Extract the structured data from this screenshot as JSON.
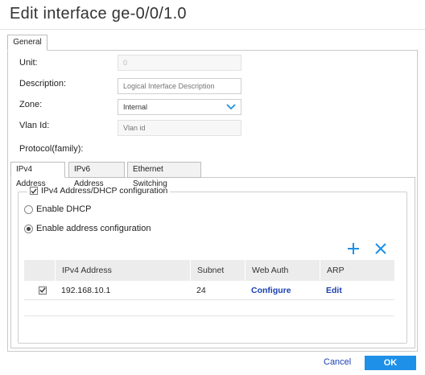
{
  "dialog": {
    "title": "Edit interface ge-0/0/1.0"
  },
  "outer_tab": "General",
  "form": {
    "unit_label": "Unit:",
    "unit_value": "0",
    "description_label": "Description:",
    "description_placeholder": "Logical Interface Description",
    "zone_label": "Zone:",
    "zone_value": "Internal",
    "vlan_label": "Vlan Id:",
    "vlan_placeholder": "Vlan id",
    "protocol_label": "Protocol(family):"
  },
  "sub_tabs": [
    "IPv4 Address",
    "IPv6 Address",
    "Ethernet Switching"
  ],
  "ipv4": {
    "legend": "IPv4 Address/DHCP configuration",
    "legend_checked": true,
    "enable_dhcp": "Enable DHCP",
    "enable_address_config": "Enable address configuration",
    "selected_option": "enable_address_config"
  },
  "table": {
    "columns": [
      "IPv4 Address",
      "Subnet",
      "Web Auth",
      "ARP"
    ],
    "rows": [
      {
        "checked": true,
        "address": "192.168.10.1",
        "subnet": "24",
        "web_auth": "Configure",
        "arp": "Edit"
      }
    ]
  },
  "footer": {
    "cancel": "Cancel",
    "ok": "OK"
  },
  "colors": {
    "accent": "#1e90e8",
    "link": "#1b3fb0"
  },
  "icons": {
    "add": "plus-icon",
    "delete": "close-icon",
    "zone_dropdown": "chevron-down-icon"
  }
}
